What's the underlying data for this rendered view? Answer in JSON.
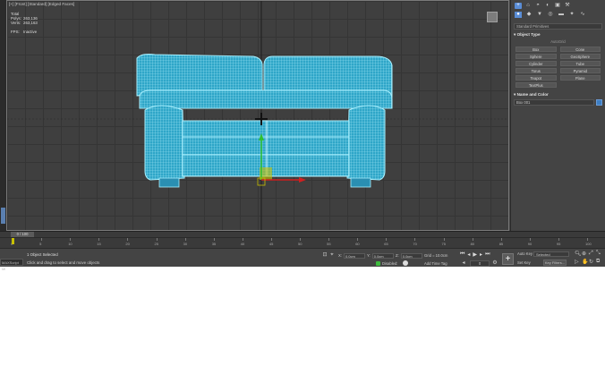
{
  "viewport": {
    "label": "[+] [Front] [Standard] [Edged Faces]",
    "stats": {
      "title": "Total",
      "polys_label": "Polys:",
      "polys_value": "263,136",
      "verts_label": "Verts:",
      "verts_value": "263,163",
      "fps_label": "FPS:",
      "fps_value": "Inactive"
    }
  },
  "command_panel": {
    "tabs": [
      "+",
      "⌂",
      "◓",
      "◐",
      "▣",
      "⚒"
    ],
    "create_tabs": [
      "●",
      "◆",
      "▼",
      "◎",
      "▬",
      "✦",
      "∿"
    ],
    "category": "Standard Primitives",
    "object_type_title": "Object Type",
    "autogrid": "AutoGrid",
    "objects": [
      "Box",
      "Cone",
      "Sphere",
      "GeoSphere",
      "Cylinder",
      "Tube",
      "Torus",
      "Pyramid",
      "Teapot",
      "Plane",
      "TextPlus",
      ""
    ],
    "name_color_title": "Name and Color",
    "name_value": "Box 001",
    "color": "#3d7fc4"
  },
  "timeline": {
    "slider_label": "0 / 100",
    "ticks": [
      "0",
      "5",
      "10",
      "15",
      "20",
      "25",
      "30",
      "35",
      "40",
      "45",
      "50",
      "55",
      "60",
      "65",
      "70",
      "75",
      "80",
      "85",
      "90",
      "95",
      "100"
    ]
  },
  "statusbar": {
    "maxscript": "MAXScript Mi",
    "selected": "1 Object Selected",
    "prompt": "Click and drag to select and move objects",
    "x_label": "X:",
    "x_value": "0.0cm",
    "y_label": "Y:",
    "y_value": "0.0cm",
    "z_label": "Z:",
    "z_value": "0.0cm",
    "grid": "Grid = 10.0cm",
    "add_time_tag": "Add Time Tag",
    "disabled": "Disabled:",
    "frame": "0",
    "auto_key": "Auto Key",
    "set_key": "Set Key",
    "selected_dd": "Selected",
    "key_filters": "Key Filters..."
  }
}
